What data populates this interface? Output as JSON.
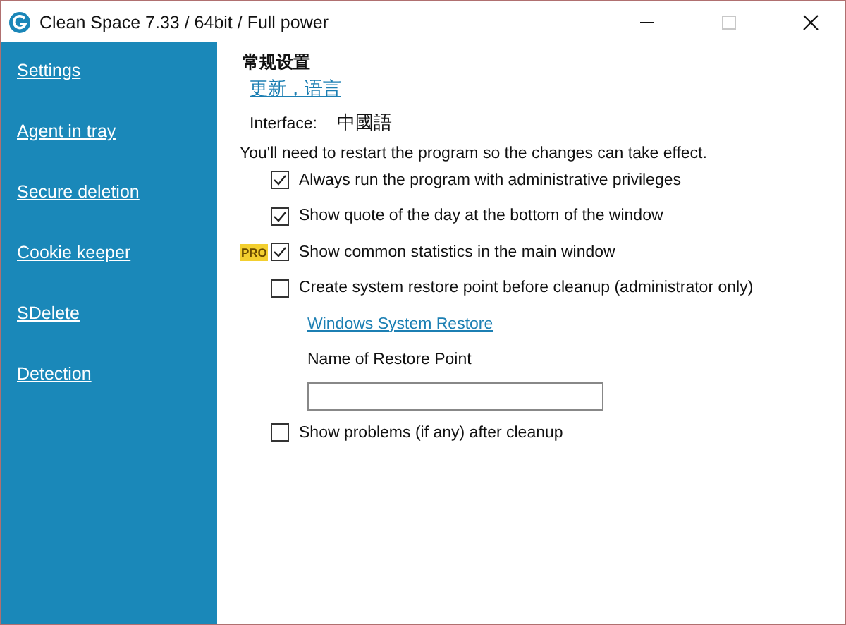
{
  "window": {
    "title": "Clean Space 7.33 / 64bit / Full power"
  },
  "sidebar": {
    "items": [
      {
        "label": "Settings"
      },
      {
        "label": "Agent in tray"
      },
      {
        "label": "Secure deletion"
      },
      {
        "label": "Cookie keeper"
      },
      {
        "label": "SDelete"
      },
      {
        "label": "Detection"
      }
    ]
  },
  "content": {
    "heading": "常规设置",
    "link": "更新，语言",
    "interface_label": "Interface:",
    "interface_value": "中國語",
    "note": "You'll need to restart the program so the changes can take effect.",
    "options": [
      {
        "kind": "checkbox",
        "label": "Always run the program with administrative privileges",
        "checked": true
      },
      {
        "kind": "checkbox",
        "label": "Show quote of the day at the bottom of the window",
        "checked": true
      },
      {
        "kind": "checkbox",
        "label": "Show common statistics in the main window",
        "checked": true,
        "badge": "PRO"
      },
      {
        "kind": "checkbox",
        "label": "Create system restore point before cleanup (administrator only)",
        "checked": false
      },
      {
        "kind": "link",
        "label": "Windows System Restore"
      },
      {
        "kind": "label",
        "label": "Name of Restore Point"
      },
      {
        "kind": "field"
      },
      {
        "kind": "checkbox",
        "label": "Show problems (if any) after cleanup",
        "checked": false
      }
    ]
  }
}
